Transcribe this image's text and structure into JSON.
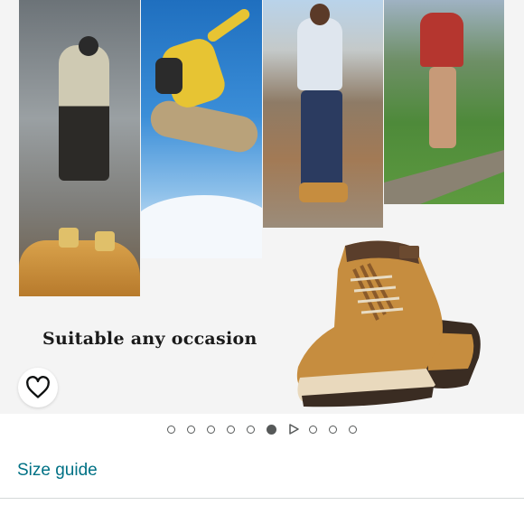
{
  "hero": {
    "slogan": "Suitable any occasion",
    "photos": [
      "photographer-photo",
      "jumping-hiker-photo",
      "woman-standing-photo",
      "trail-hiker-photo"
    ]
  },
  "wishlist": {
    "icon": "heart-icon"
  },
  "carousel": {
    "total": 10,
    "active_index": 5,
    "video_index": 6
  },
  "links": {
    "size_guide": "Size guide"
  },
  "colors": {
    "link": "#007185",
    "dot": "#565959",
    "boot": "#c68d3f"
  }
}
